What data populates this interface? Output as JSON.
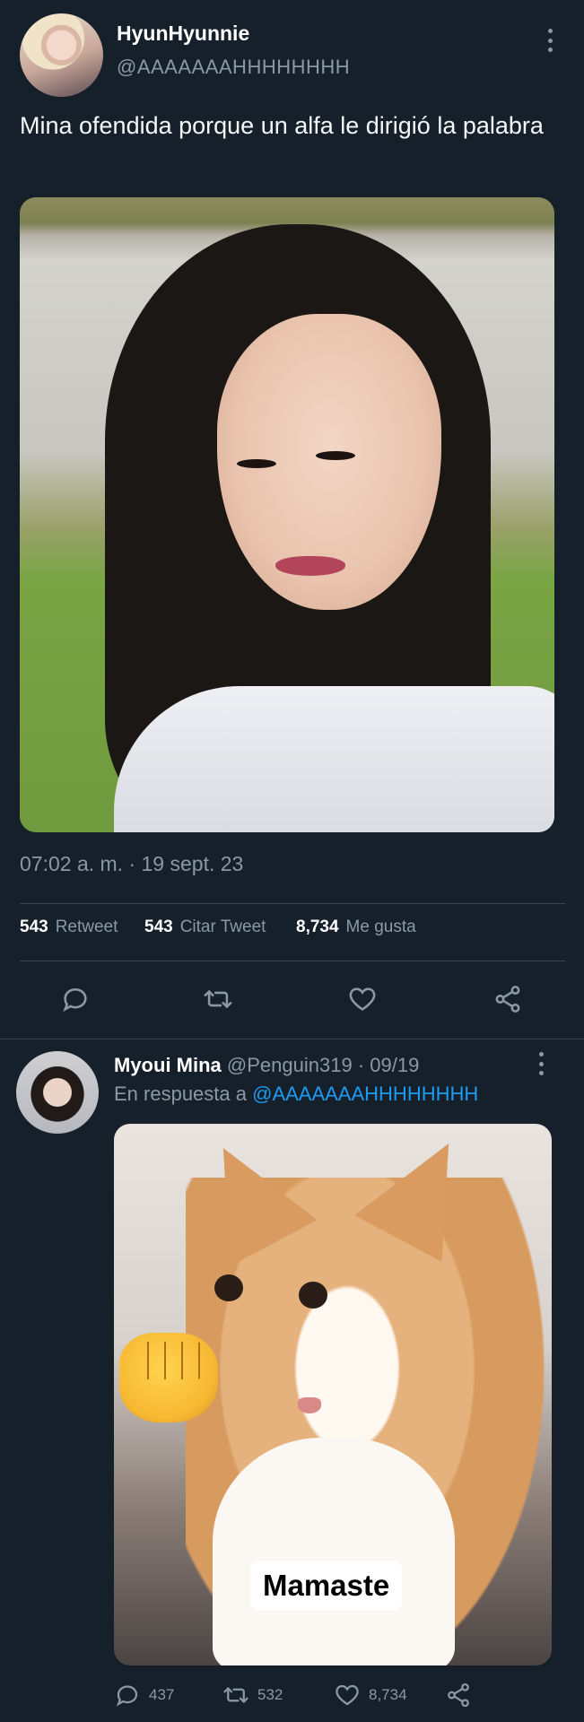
{
  "tweet": {
    "display_name": "HyunHyunnie",
    "handle": "@AAAAAAAHHHHHHHH",
    "text": "Mina ofendida porque un alfa le dirigió la palabra",
    "timestamp": "07:02 a. m. · 19 sept. 23",
    "stats": {
      "retweets_count": "543",
      "retweets_label": "Retweet",
      "quotes_count": "543",
      "quotes_label": "Citar Tweet",
      "likes_count": "8,734",
      "likes_label": "Me gusta"
    },
    "actions": [
      "reply-icon",
      "retweet-icon",
      "heart-icon",
      "share-icon"
    ]
  },
  "reply": {
    "display_name": "Myoui Mina",
    "handle": "@Penguin319",
    "date": "· 09/19",
    "in_reply_to_label": "En respuesta a",
    "in_reply_to_handle": "@AAAAAAAHHHHHHHH",
    "image_caption": "Mamaste",
    "counts": {
      "replies": "437",
      "retweets": "532",
      "likes": "8,734"
    }
  },
  "colors": {
    "background": "#15202b",
    "text": "#e7e9ea",
    "muted": "#8b98a5",
    "divider": "#38444d",
    "link": "#1d9bf0"
  }
}
